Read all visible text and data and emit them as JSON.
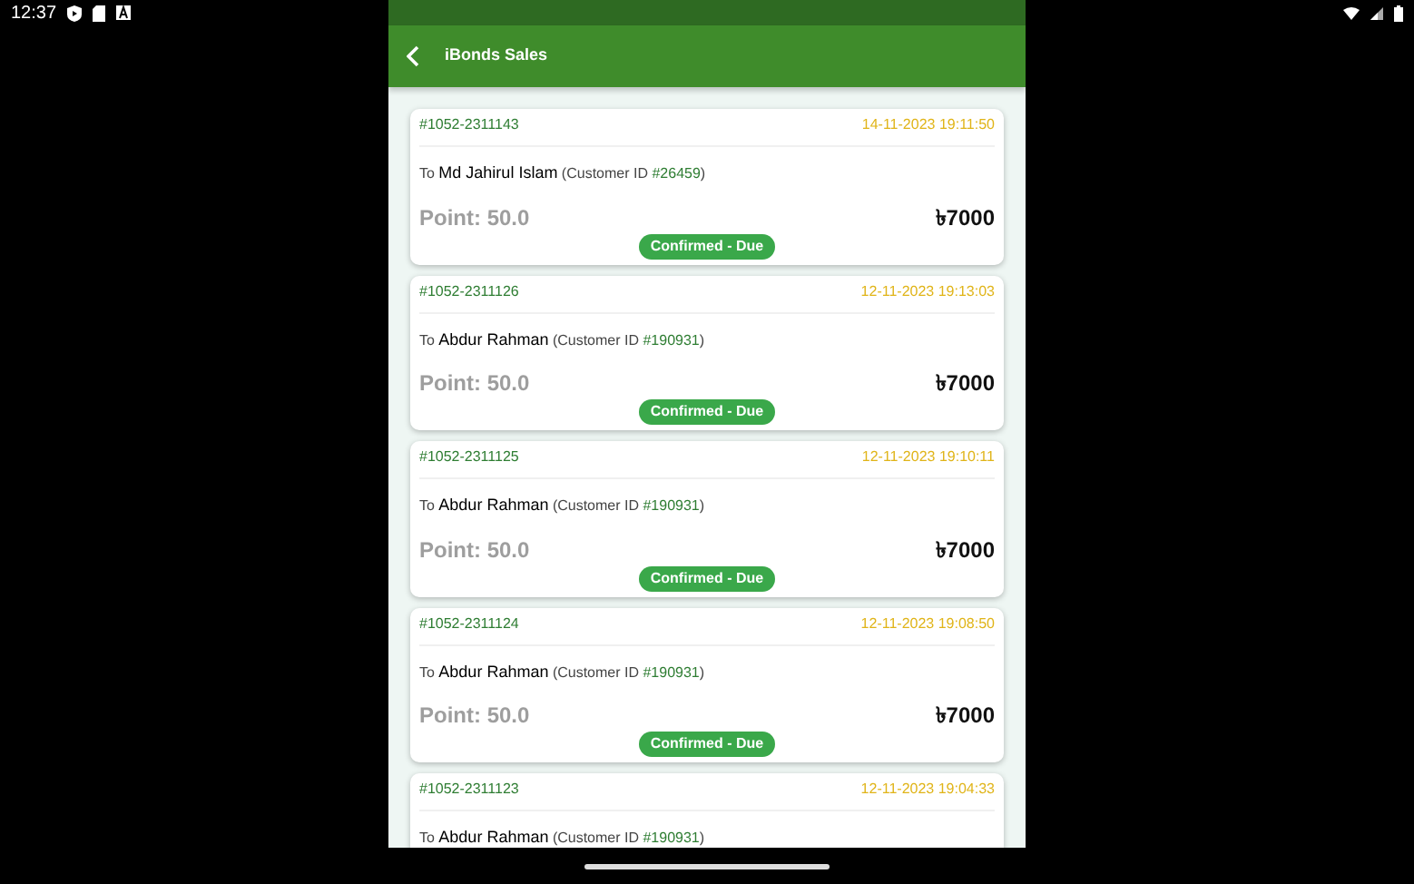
{
  "status_bar": {
    "time": "12:37"
  },
  "header": {
    "title": "iBonds Sales"
  },
  "sales": [
    {
      "order_id": "#1052-2311143",
      "date": "14-11-2023 19:11:50",
      "to_label": "To",
      "customer_name": "Md Jahirul Islam",
      "customer_id_label": "(Customer ID ",
      "customer_id": "#26459",
      "customer_id_close": ")",
      "point": "Point: 50.0",
      "amount": "৳7000",
      "status": "Confirmed - Due"
    },
    {
      "order_id": "#1052-2311126",
      "date": "12-11-2023 19:13:03",
      "to_label": "To",
      "customer_name": "Abdur Rahman",
      "customer_id_label": "(Customer ID ",
      "customer_id": "#190931",
      "customer_id_close": ")",
      "point": "Point: 50.0",
      "amount": "৳7000",
      "status": "Confirmed - Due"
    },
    {
      "order_id": "#1052-2311125",
      "date": "12-11-2023 19:10:11",
      "to_label": "To",
      "customer_name": "Abdur Rahman",
      "customer_id_label": "(Customer ID ",
      "customer_id": "#190931",
      "customer_id_close": ")",
      "point": "Point: 50.0",
      "amount": "৳7000",
      "status": "Confirmed - Due"
    },
    {
      "order_id": "#1052-2311124",
      "date": "12-11-2023 19:08:50",
      "to_label": "To",
      "customer_name": "Abdur Rahman",
      "customer_id_label": "(Customer ID ",
      "customer_id": "#190931",
      "customer_id_close": ")",
      "point": "Point: 50.0",
      "amount": "৳7000",
      "status": "Confirmed - Due"
    },
    {
      "order_id": "#1052-2311123",
      "date": "12-11-2023 19:04:33",
      "to_label": "To",
      "customer_name": "Abdur Rahman",
      "customer_id_label": "(Customer ID ",
      "customer_id": "#190931",
      "customer_id_close": ")"
    }
  ]
}
